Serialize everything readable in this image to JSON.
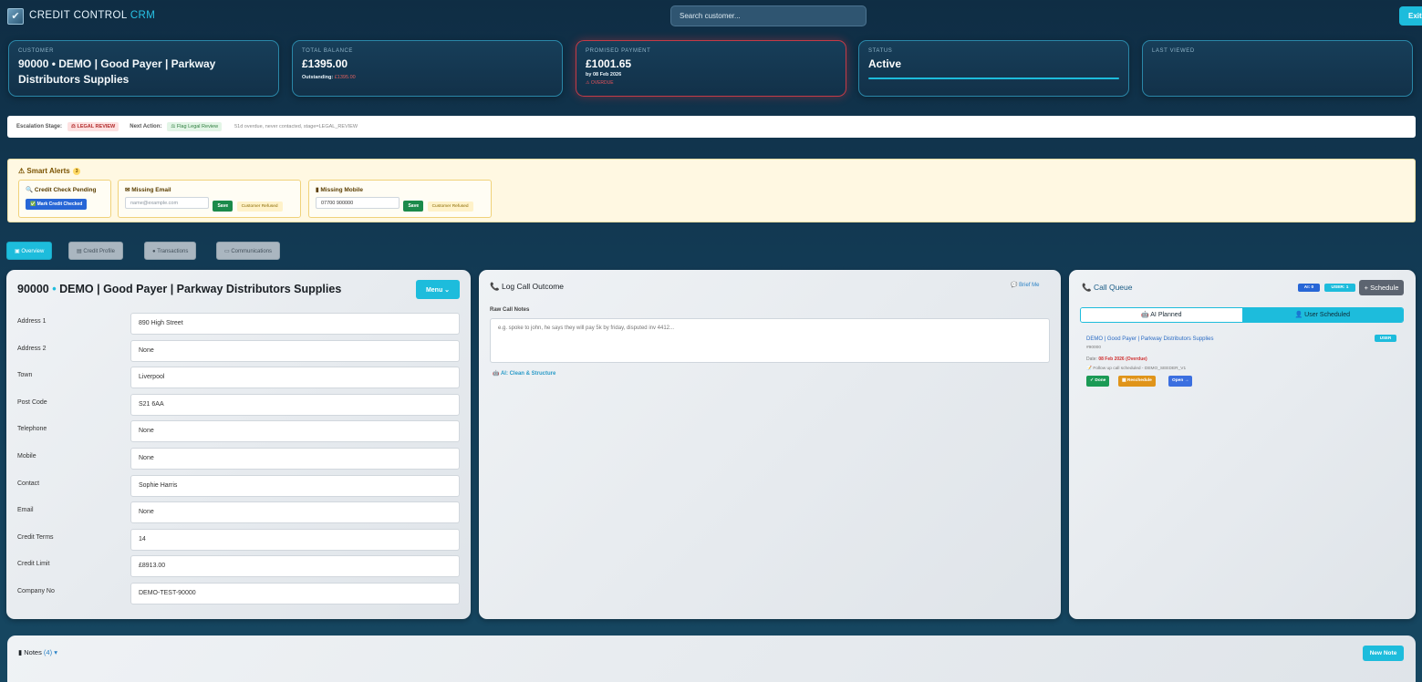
{
  "app": {
    "title_main": "CREDIT CONTROL",
    "title_accent": "CRM",
    "logo_icon": "logo-icon"
  },
  "search": {
    "placeholder": "Search customer..."
  },
  "exit_label": "Exit",
  "summary": {
    "customer": {
      "label": "CUSTOMER",
      "value": "90000 • DEMO | Good Payer | Parkway Distributors Supplies"
    },
    "balance": {
      "label": "TOTAL BALANCE",
      "value": "£1395.00",
      "outstanding_label": "Outstanding:",
      "outstanding_value": "£1395.00"
    },
    "promised": {
      "label": "PROMISED PAYMENT",
      "value": "£1001.65",
      "by": "by 08 Feb 2026",
      "flag": "⚠ OVERDUE"
    },
    "status": {
      "label": "STATUS",
      "value": "Active"
    },
    "last_viewed": {
      "label": "LAST VIEWED",
      "value": ""
    }
  },
  "escalation": {
    "stage_label": "Escalation Stage:",
    "stage_value": "LEGAL REVIEW",
    "next_label": "Next Action:",
    "next_value": "Flag Legal Review",
    "note": "51d overdue, never contacted, stage=LEGAL_REVIEW"
  },
  "alerts": {
    "title": "Smart Alerts",
    "count": "3",
    "credit": {
      "title": "Credit Check Pending",
      "button": "Mark Credit Checked"
    },
    "email": {
      "title": "Missing Email",
      "placeholder": "name@example.com",
      "save": "Save",
      "refused": "Customer Refused"
    },
    "mobile": {
      "title": "Missing Mobile",
      "value": "07700 900000",
      "save": "Save",
      "refused": "Customer Refused"
    }
  },
  "tabs": [
    "Overview",
    "Credit Profile",
    "Transactions",
    "Communications"
  ],
  "customer": {
    "id": "90000",
    "name": "DEMO | Good Payer | Parkway Distributors Supplies",
    "menu": "Menu ⌄",
    "fields": [
      {
        "label": "Address 1",
        "value": "890 High Street"
      },
      {
        "label": "Address 2",
        "value": "None"
      },
      {
        "label": "Town",
        "value": "Liverpool"
      },
      {
        "label": "Post Code",
        "value": "S21 6AA"
      },
      {
        "label": "Telephone",
        "value": "None"
      },
      {
        "label": "Mobile",
        "value": "None"
      },
      {
        "label": "Contact",
        "value": "Sophie Harris"
      },
      {
        "label": "Email",
        "value": "None"
      },
      {
        "label": "Credit Terms",
        "value": "14"
      },
      {
        "label": "Credit Limit",
        "value": "£8913.00"
      },
      {
        "label": "Company No",
        "value": "DEMO-TEST-90000"
      }
    ]
  },
  "log_call": {
    "title": "Log Call Outcome",
    "brief": "Brief Me",
    "raw_label": "Raw Call Notes",
    "placeholder": "e.g. spoke to john, he says they will pay 5k by friday, disputed inv 4412...",
    "ai_clean": "AI: Clean & Structure"
  },
  "call_queue": {
    "title": "Call Queue",
    "ai_badge": "AI: 0",
    "user_badge": "USER: 1",
    "schedule": "+ Schedule",
    "seg_ai": "AI Planned",
    "seg_user": "User Scheduled",
    "item": {
      "name": "DEMO | Good Payer | Parkway Distributors Supplies",
      "badge": "USER",
      "id": "#90000",
      "date_label": "Date:",
      "date_value": "08 Feb 2026 (Overdue)",
      "note": "Follow up call scheduled - DEMO_SEEDER_V1",
      "done": "✓ Done",
      "reschedule": "Reschedule",
      "open": "Open →"
    }
  },
  "notes": {
    "title": "Notes",
    "count": "(4)",
    "new_note": "New Note"
  }
}
